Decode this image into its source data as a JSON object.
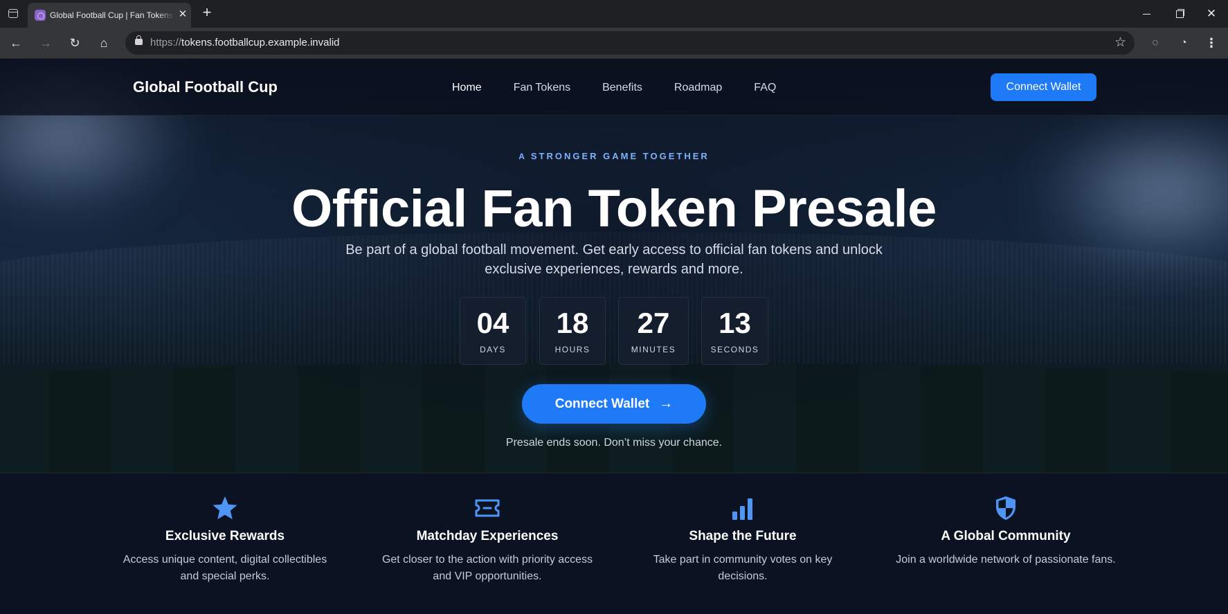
{
  "browser": {
    "tab_title": "Global Football Cup | Fan Tokens",
    "url_prefix": "https://",
    "url_host": "tokens.footballcup.example.invalid"
  },
  "header": {
    "brand": "Global Football Cup",
    "nav": [
      "Home",
      "Fan Tokens",
      "Benefits",
      "Roadmap",
      "FAQ"
    ],
    "active_nav": "Home",
    "cta": "Connect Wallet"
  },
  "hero": {
    "eyebrow": "STRONGER GAME TOGETHER",
    "eyebrow_icon": "A",
    "headline": "Official Fan Token Presale",
    "subline": "Be part of a global football movement. Get early access to official fan tokens and unlock exclusive experiences, rewards and more.",
    "countdown": [
      {
        "value": "04",
        "label": "DAYS"
      },
      {
        "value": "18",
        "label": "HOURS"
      },
      {
        "value": "27",
        "label": "MINUTES"
      },
      {
        "value": "13",
        "label": "SECONDS"
      }
    ],
    "cta": "Connect Wallet",
    "note": "Presale ends soon. Don’t miss your chance."
  },
  "features": [
    {
      "icon": "star-icon",
      "title": "Exclusive Rewards",
      "description": "Access unique content, digital collectibles and special perks."
    },
    {
      "icon": "ticket-icon",
      "title": "Matchday Experiences",
      "description": "Get closer to the action with priority access and VIP opportunities."
    },
    {
      "icon": "bar-chart-icon",
      "title": "Shape the Future",
      "description": "Take part in community votes on key decisions."
    },
    {
      "icon": "shield-icon",
      "title": "A Global Community",
      "description": "Join a worldwide network of passionate fans."
    }
  ],
  "colors": {
    "accent": "#1f7af7",
    "eyebrow": "#7fb1ff",
    "feature_icon": "#4f95f5",
    "background": "#0b1220"
  }
}
